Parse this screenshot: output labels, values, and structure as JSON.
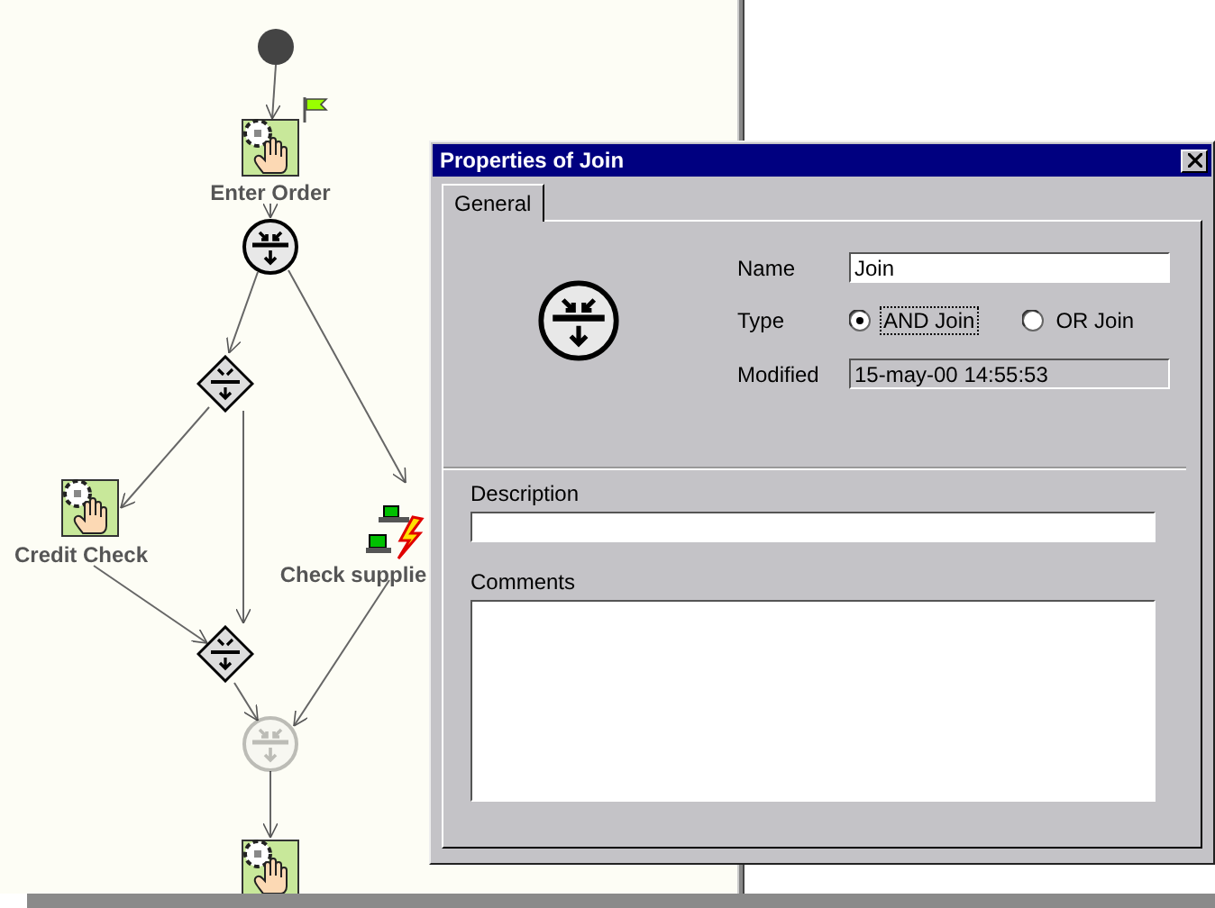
{
  "diagram": {
    "nodes": [
      {
        "kind": "start",
        "dimmed": false,
        "flagged": false
      },
      {
        "kind": "activity",
        "label": "Enter Order",
        "dimmed": false,
        "flagged": true
      },
      {
        "kind": "split",
        "dimmed": false,
        "flagged": false
      },
      {
        "kind": "gateway",
        "dimmed": false,
        "flagged": false
      },
      {
        "kind": "activity",
        "label": "Credit Check",
        "dimmed": false,
        "flagged": false
      },
      {
        "kind": "application",
        "label": "Check supplie",
        "dimmed": false,
        "flagged": false
      },
      {
        "kind": "gateway",
        "dimmed": false,
        "flagged": false
      },
      {
        "kind": "join",
        "dimmed": true,
        "flagged": false
      },
      {
        "kind": "activity",
        "dimmed": false,
        "flagged": false
      }
    ]
  },
  "dialog": {
    "title": "Properties of Join",
    "tabs": [
      {
        "label": "General",
        "selected": true
      }
    ],
    "name": {
      "label": "Name",
      "value": "Join"
    },
    "type": {
      "label": "Type",
      "options": [
        {
          "label": "AND Join",
          "selected": true,
          "focused": true
        },
        {
          "label": "OR Join",
          "selected": false,
          "focused": false
        }
      ]
    },
    "modified": {
      "label": "Modified",
      "value": "15-may-00 14:55:53"
    },
    "description": {
      "label": "Description"
    },
    "comments": {
      "label": "Comments"
    }
  }
}
